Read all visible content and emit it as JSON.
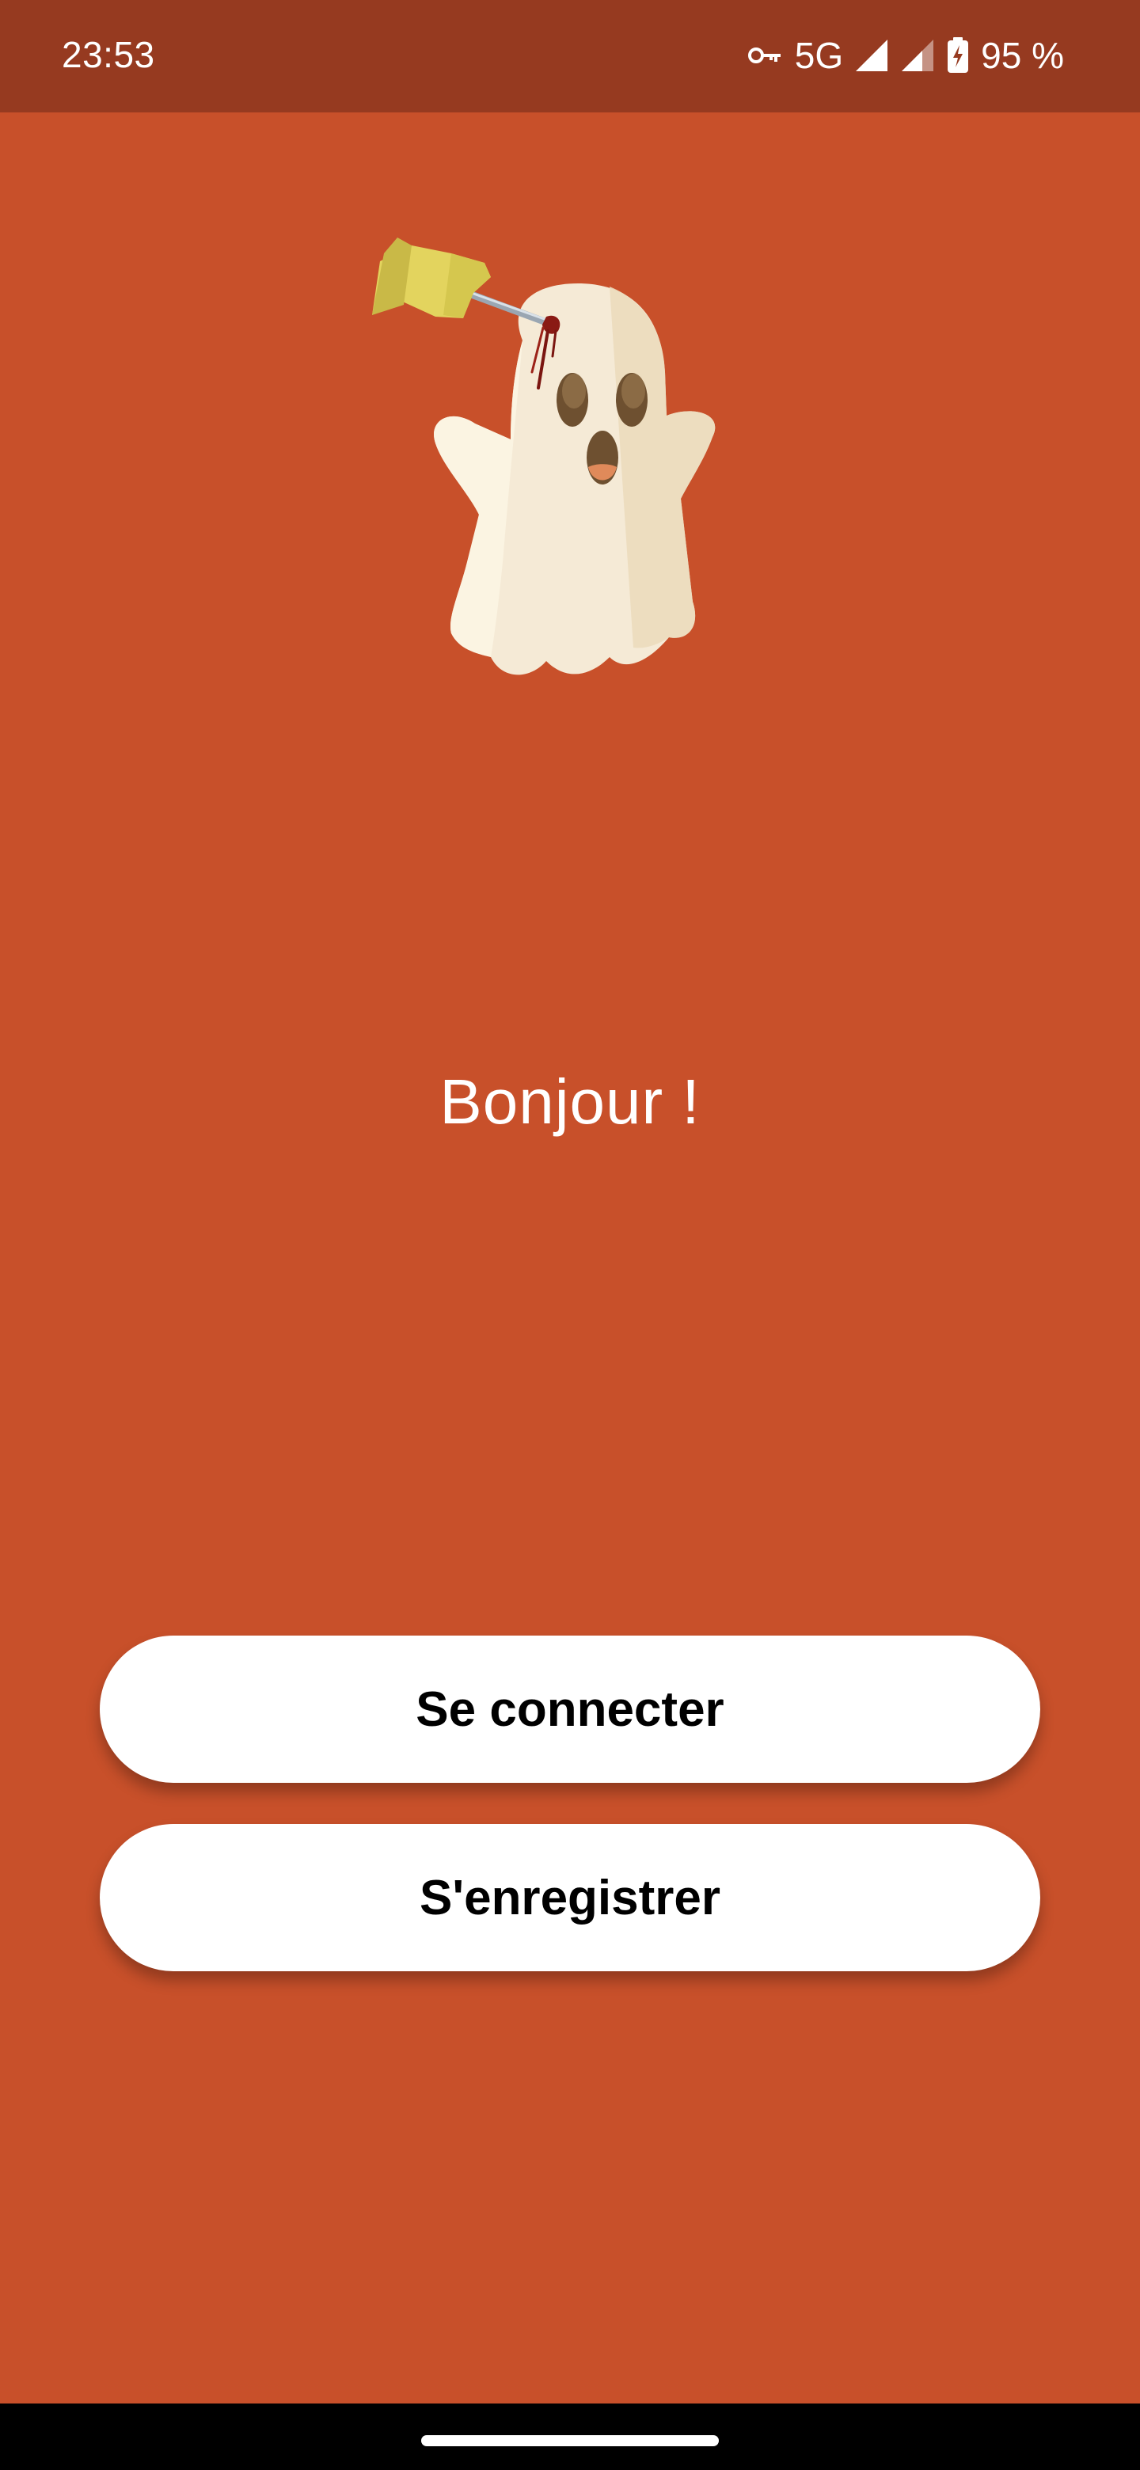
{
  "status_bar": {
    "time": "23:53",
    "network": "5G",
    "battery": "95 %",
    "icons": [
      "vpn-key-icon",
      "signal-icon",
      "signal-icon",
      "battery-charging-icon"
    ]
  },
  "welcome": {
    "greeting": "Bonjour !"
  },
  "actions": {
    "login_label": "Se connecter",
    "register_label": "S'enregistrer"
  },
  "colors": {
    "background": "#c8502a",
    "status_bar": "#963a20",
    "button": "#ffffff",
    "button_text": "#000000",
    "nav_bar": "#000000"
  }
}
